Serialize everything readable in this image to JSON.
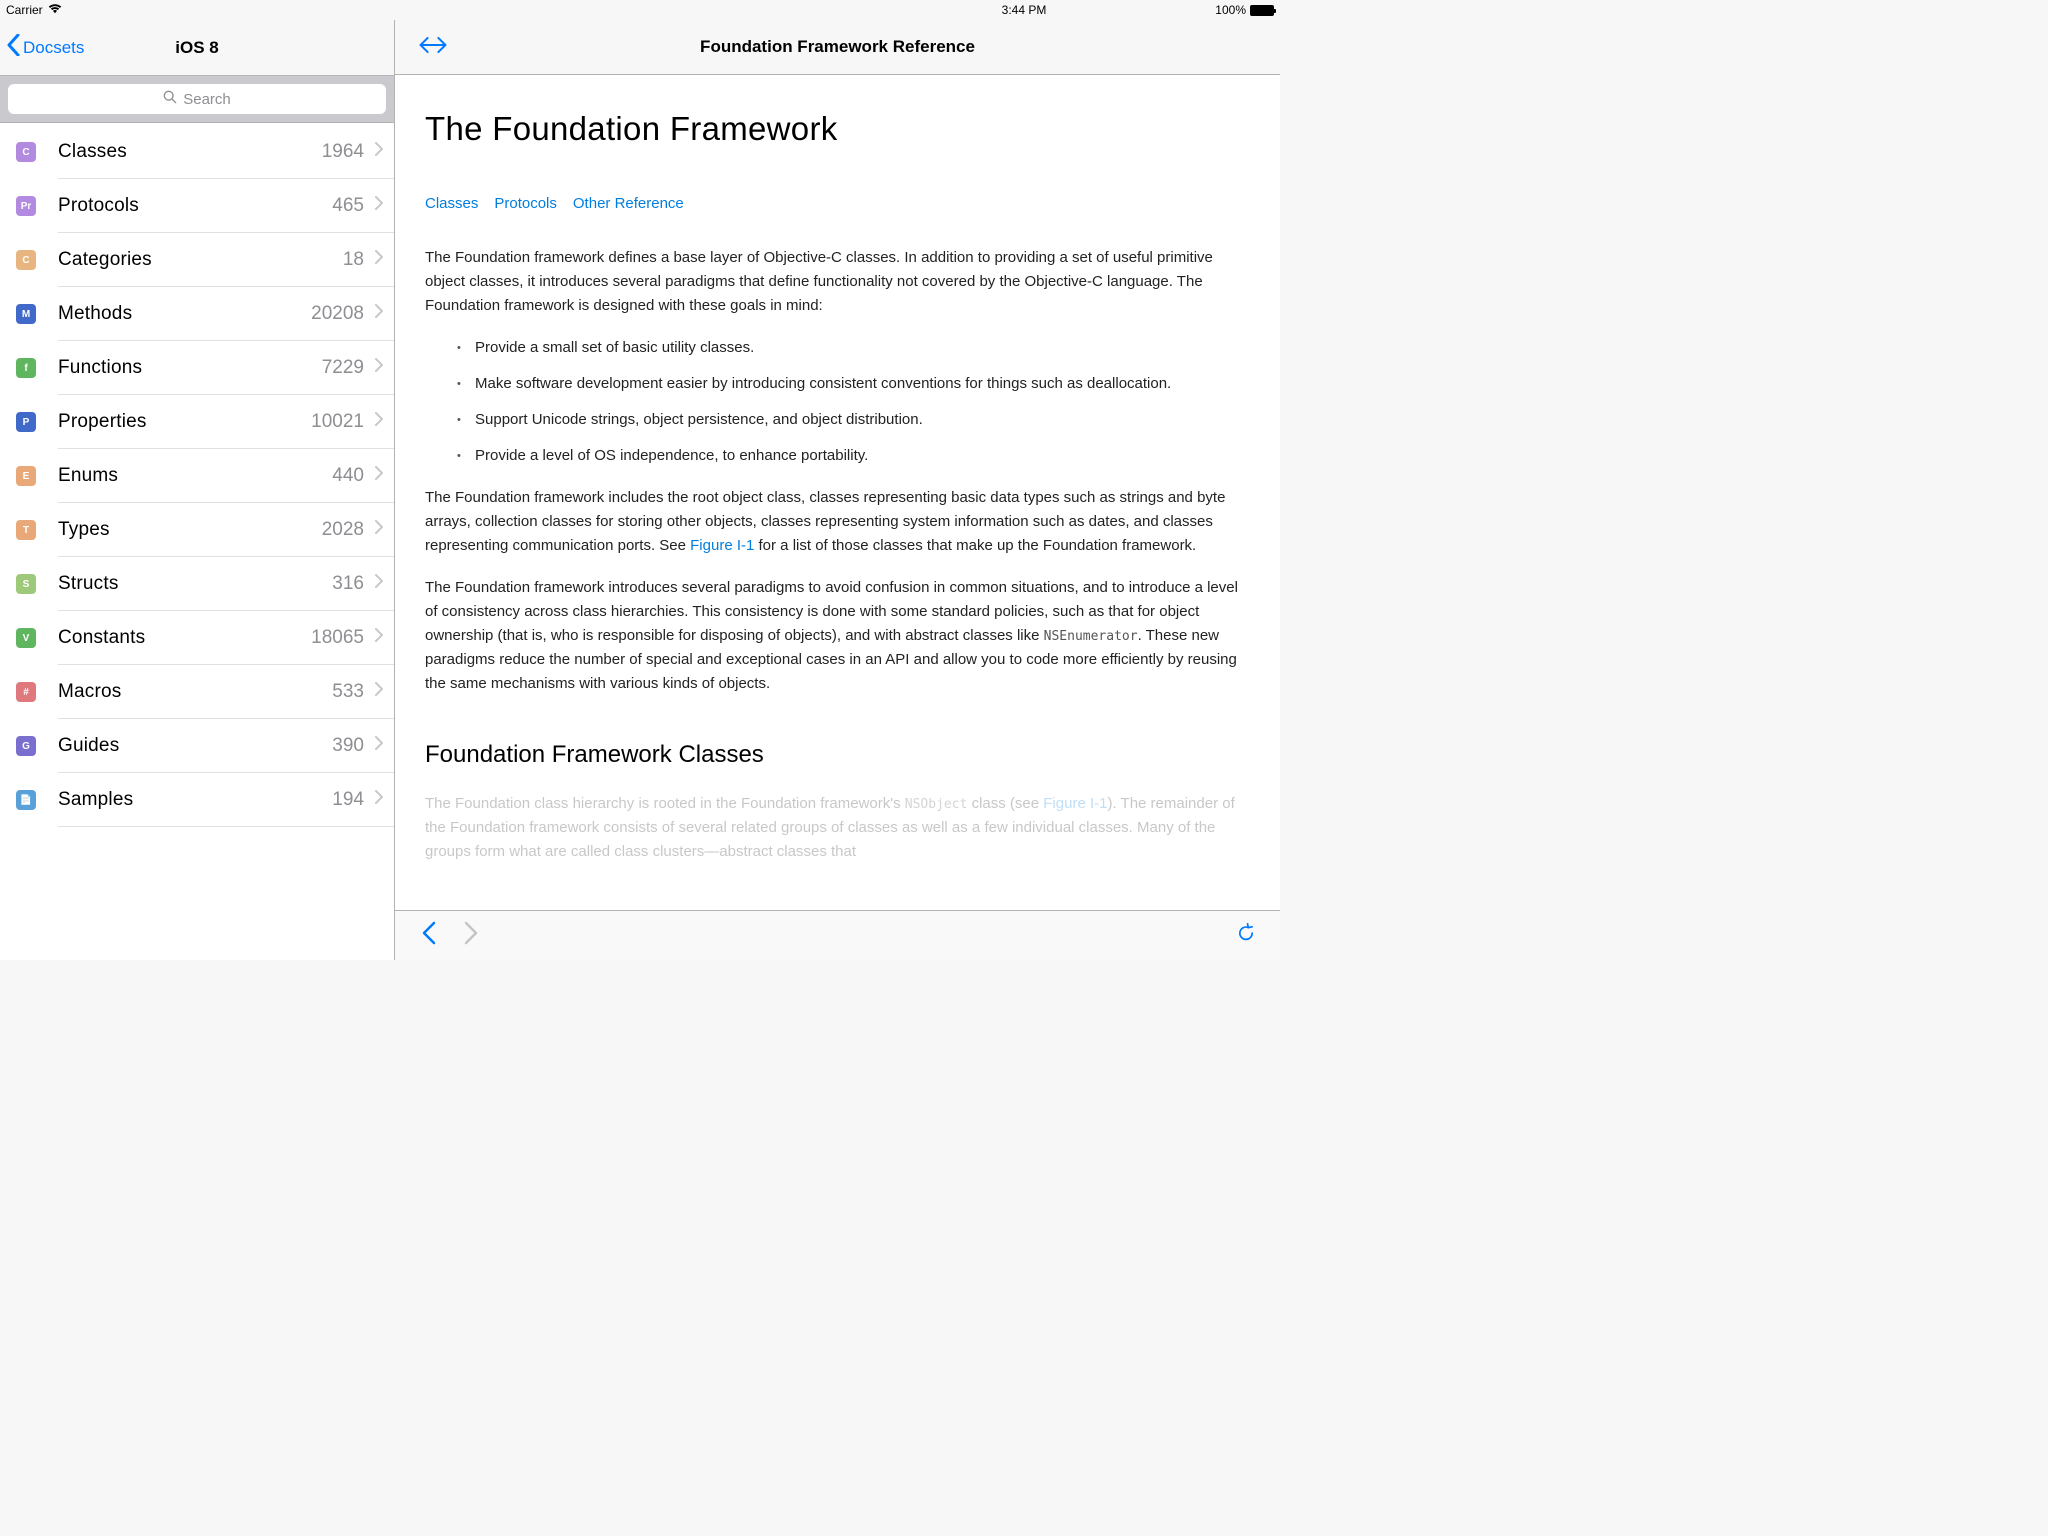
{
  "status": {
    "carrier": "Carrier",
    "time": "3:44 PM",
    "battery": "100%"
  },
  "sidebar": {
    "back_label": "Docsets",
    "title": "iOS 8",
    "search_placeholder": "Search",
    "categories": [
      {
        "label": "Classes",
        "count": "1964",
        "icon": "C",
        "bg": "#b28ae0",
        "data_name": "classes"
      },
      {
        "label": "Protocols",
        "count": "465",
        "icon": "Pr",
        "bg": "#b28ae0",
        "data_name": "protocols"
      },
      {
        "label": "Categories",
        "count": "18",
        "icon": "C",
        "bg": "#e8b580",
        "data_name": "categories"
      },
      {
        "label": "Methods",
        "count": "20208",
        "icon": "M",
        "bg": "#4169c9",
        "data_name": "methods"
      },
      {
        "label": "Functions",
        "count": "7229",
        "icon": "f",
        "bg": "#5fb65f",
        "data_name": "functions"
      },
      {
        "label": "Properties",
        "count": "10021",
        "icon": "P",
        "bg": "#4169c9",
        "data_name": "properties"
      },
      {
        "label": "Enums",
        "count": "440",
        "icon": "E",
        "bg": "#e8a878",
        "data_name": "enums"
      },
      {
        "label": "Types",
        "count": "2028",
        "icon": "T",
        "bg": "#e8a878",
        "data_name": "types"
      },
      {
        "label": "Structs",
        "count": "316",
        "icon": "S",
        "bg": "#9fc97a",
        "data_name": "structs"
      },
      {
        "label": "Constants",
        "count": "18065",
        "icon": "V",
        "bg": "#5fb65f",
        "data_name": "constants"
      },
      {
        "label": "Macros",
        "count": "533",
        "icon": "#",
        "bg": "#e0797d",
        "data_name": "macros"
      },
      {
        "label": "Guides",
        "count": "390",
        "icon": "G",
        "bg": "#7a6fcf",
        "data_name": "guides"
      },
      {
        "label": "Samples",
        "count": "194",
        "icon": "📄",
        "bg": "#5aa0d8",
        "data_name": "samples"
      }
    ]
  },
  "main": {
    "nav_title": "Foundation Framework Reference",
    "doc_title": "The Foundation Framework",
    "doc_links": [
      "Classes",
      "Protocols",
      "Other Reference"
    ],
    "para1": "The Foundation framework defines a base layer of Objective-C classes. In addition to providing a set of useful primitive object classes, it introduces several paradigms that define functionality not covered by the Objective-C language. The Foundation framework is designed with these goals in mind:",
    "bullets": [
      "Provide a small set of basic utility classes.",
      "Make software development easier by introducing consistent conventions for things such as deallocation.",
      "Support Unicode strings, object persistence, and object distribution.",
      "Provide a level of OS independence, to enhance portability."
    ],
    "para2_a": "The Foundation framework includes the root object class, classes representing basic data types such as strings and byte arrays, collection classes for storing other objects, classes representing system information such as dates, and classes representing communication ports. See ",
    "para2_link": "Figure I-1",
    "para2_b": " for a list of those classes that make up the Foundation framework.",
    "para3_a": "The Foundation framework introduces several paradigms to avoid confusion in common situations, and to introduce a level of consistency across class hierarchies. This consistency is done with some standard policies, such as that for object ownership (that is, who is responsible for disposing of objects), and with abstract classes like ",
    "para3_code": "NSEnumerator",
    "para3_b": ". These new paradigms reduce the number of special and exceptional cases in an API and allow you to code more efficiently by reusing the same mechanisms with various kinds of objects.",
    "h2": "Foundation Framework Classes",
    "para4_a": "The Foundation class hierarchy is rooted in the Foundation framework's ",
    "para4_code": "NSObject",
    "para4_b": " class (see ",
    "para4_link": "Figure I-1",
    "para4_c": "). The remainder of the Foundation framework consists of several related groups of classes as well as a few individual classes. Many of the groups form what are called class clusters—abstract classes that"
  }
}
